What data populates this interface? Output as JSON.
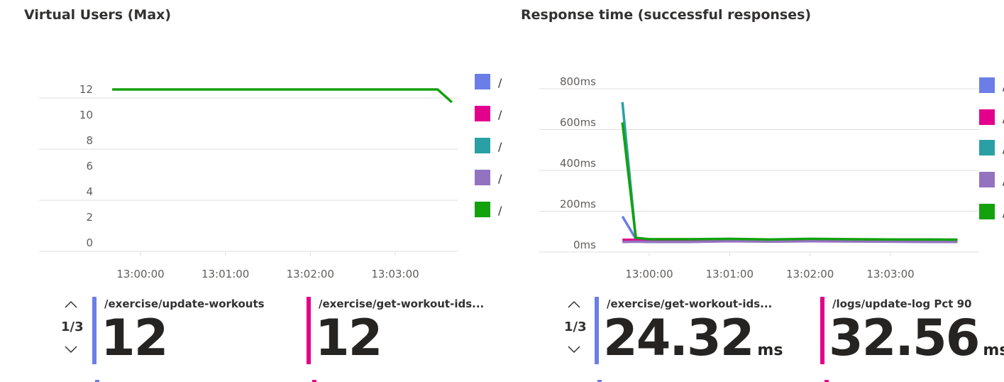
{
  "left_panel": {
    "title": "Virtual Users (Max)",
    "legend": [
      {
        "text": "/",
        "color": "#6b7ee8",
        "icon": "legend-swatch-blue"
      },
      {
        "text": "/",
        "color": "#e3008c",
        "icon": "legend-swatch-magenta"
      },
      {
        "text": "/",
        "color": "#2aa0a4",
        "icon": "legend-swatch-teal"
      },
      {
        "text": "/",
        "color": "#9373c0",
        "icon": "legend-swatch-purple"
      },
      {
        "text": "/",
        "color": "#13a10e",
        "icon": "legend-swatch-green"
      }
    ],
    "pager": "1/3",
    "metrics": [
      {
        "label": "/exercise/update-workouts",
        "value": "12",
        "unit": "",
        "color": "#6b7ee8"
      },
      {
        "label": "/exercise/get-workout-ids...",
        "value": "12",
        "unit": "",
        "color": "#e3008c"
      }
    ]
  },
  "right_panel": {
    "title": "Response time (successful responses)",
    "legend": [
      {
        "text": "/",
        "color": "#6b7ee8",
        "icon": "legend-swatch-blue"
      },
      {
        "text": "/",
        "color": "#e3008c",
        "icon": "legend-swatch-magenta"
      },
      {
        "text": "/",
        "color": "#2aa0a4",
        "icon": "legend-swatch-teal"
      },
      {
        "text": "/",
        "color": "#9373c0",
        "icon": "legend-swatch-purple"
      },
      {
        "text": "/",
        "color": "#13a10e",
        "icon": "legend-swatch-green"
      }
    ],
    "pager": "1/3",
    "metrics": [
      {
        "label": "/exercise/get-workout-ids...",
        "value": "24.32",
        "unit": "ms",
        "color": "#6b7ee8"
      },
      {
        "label": "/logs/update-log Pct 90",
        "value": "32.56",
        "unit": "ms",
        "color": "#e3008c"
      }
    ]
  },
  "chart_data": [
    {
      "type": "line",
      "title": "Virtual Users (Max)",
      "y_ticks": [
        "12",
        "10",
        "8",
        "6",
        "4",
        "2",
        "0"
      ],
      "x_ticks": [
        "13:00:00",
        "13:01:00",
        "13:02:00",
        "13:03:00"
      ],
      "ylim": [
        0,
        12
      ],
      "grid": true,
      "legend_position": "right",
      "series": [
        {
          "color": "#13a10e",
          "x": [
            "12:59:40",
            "13:03:30",
            "13:03:40"
          ],
          "values": [
            12,
            12,
            11
          ]
        }
      ]
    },
    {
      "type": "line",
      "title": "Response time (successful responses)",
      "y_ticks": [
        "800ms",
        "600ms",
        "400ms",
        "200ms",
        "0ms"
      ],
      "x_ticks": [
        "13:00:00",
        "13:01:00",
        "13:02:00",
        "13:03:00"
      ],
      "ylim": [
        0,
        800
      ],
      "grid": true,
      "legend_position": "right",
      "series": [
        {
          "color": "#2aa0a4",
          "x": [
            "12:59:40",
            "12:59:50",
            "13:00:00",
            "13:00:30",
            "13:01:00",
            "13:01:30",
            "13:02:00",
            "13:02:30",
            "13:03:00",
            "13:03:30",
            "13:03:50"
          ],
          "values": [
            700,
            30,
            25,
            25,
            27,
            26,
            27,
            26,
            25,
            25,
            24
          ]
        },
        {
          "color": "#6b7ee8",
          "x": [
            "12:59:40",
            "12:59:50",
            "13:00:00",
            "13:00:30",
            "13:01:00",
            "13:01:30",
            "13:02:00",
            "13:02:30",
            "13:03:00",
            "13:03:30",
            "13:03:50"
          ],
          "values": [
            140,
            30,
            22,
            23,
            24,
            23,
            24,
            24,
            23,
            23,
            22
          ]
        },
        {
          "color": "#e3008c",
          "x": [
            "12:59:40",
            "12:59:50",
            "13:00:00",
            "13:00:30",
            "13:01:00",
            "13:01:30",
            "13:02:00",
            "13:02:30",
            "13:03:00",
            "13:03:30",
            "13:03:50"
          ],
          "values": [
            25,
            25,
            24,
            24,
            25,
            25,
            26,
            25,
            25,
            25,
            25
          ]
        },
        {
          "color": "#9373c0",
          "x": [
            "12:59:40",
            "12:59:50",
            "13:00:00",
            "13:00:30",
            "13:01:00",
            "13:01:30",
            "13:02:00",
            "13:02:30",
            "13:03:00",
            "13:03:30",
            "13:03:50"
          ],
          "values": [
            15,
            16,
            15,
            15,
            18,
            16,
            18,
            17,
            16,
            15,
            15
          ]
        },
        {
          "color": "#13a10e",
          "x": [
            "12:59:40",
            "12:59:50",
            "13:00:00",
            "13:00:30",
            "13:01:00",
            "13:01:30",
            "13:02:00",
            "13:02:30",
            "13:03:00",
            "13:03:30",
            "13:03:50"
          ],
          "values": [
            600,
            35,
            28,
            28,
            30,
            27,
            30,
            28,
            27,
            27,
            26
          ]
        }
      ]
    }
  ]
}
